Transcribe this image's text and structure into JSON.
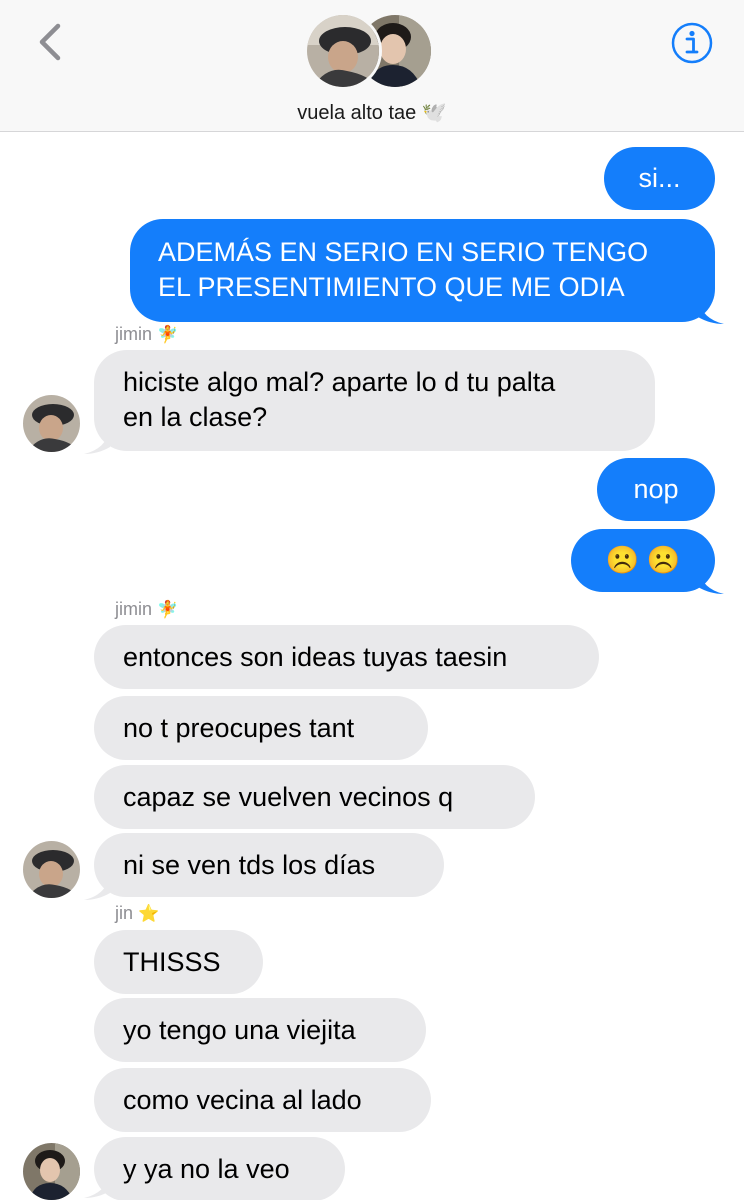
{
  "header": {
    "group_name": "vuela alto tae",
    "group_emoji": "🕊️"
  },
  "colors": {
    "sent_bubble": "#147efb",
    "received_bubble": "#e9e9eb",
    "accent": "#147efb"
  },
  "icons": {
    "back": "chevron-left-icon",
    "info": "info-circle-icon"
  },
  "messages": {
    "m1": "si...",
    "m2a": "ADEMÁS EN SERIO EN SERIO TENGO",
    "m2b": "EL PRESENTIMIENTO QUE ME ODIA",
    "sender1_name": "jimin",
    "sender1_emoji": "🧚",
    "m3a": "hiciste algo mal? aparte lo d tu palta",
    "m3b": "en la clase?",
    "m4": "nop",
    "m5": "☹️ ☹️",
    "sender2_name": "jimin",
    "sender2_emoji": "🧚",
    "m6": "entonces son ideas tuyas taesin",
    "m7": "no t preocupes tant",
    "m8": "capaz se vuelven vecinos q",
    "m9": "ni se ven tds los días",
    "sender3_name": "jin",
    "sender3_emoji": "⭐",
    "m10": "THISSS",
    "m11": "yo tengo una viejita",
    "m12": "como vecina al lado",
    "m13": "y ya no la veo"
  }
}
